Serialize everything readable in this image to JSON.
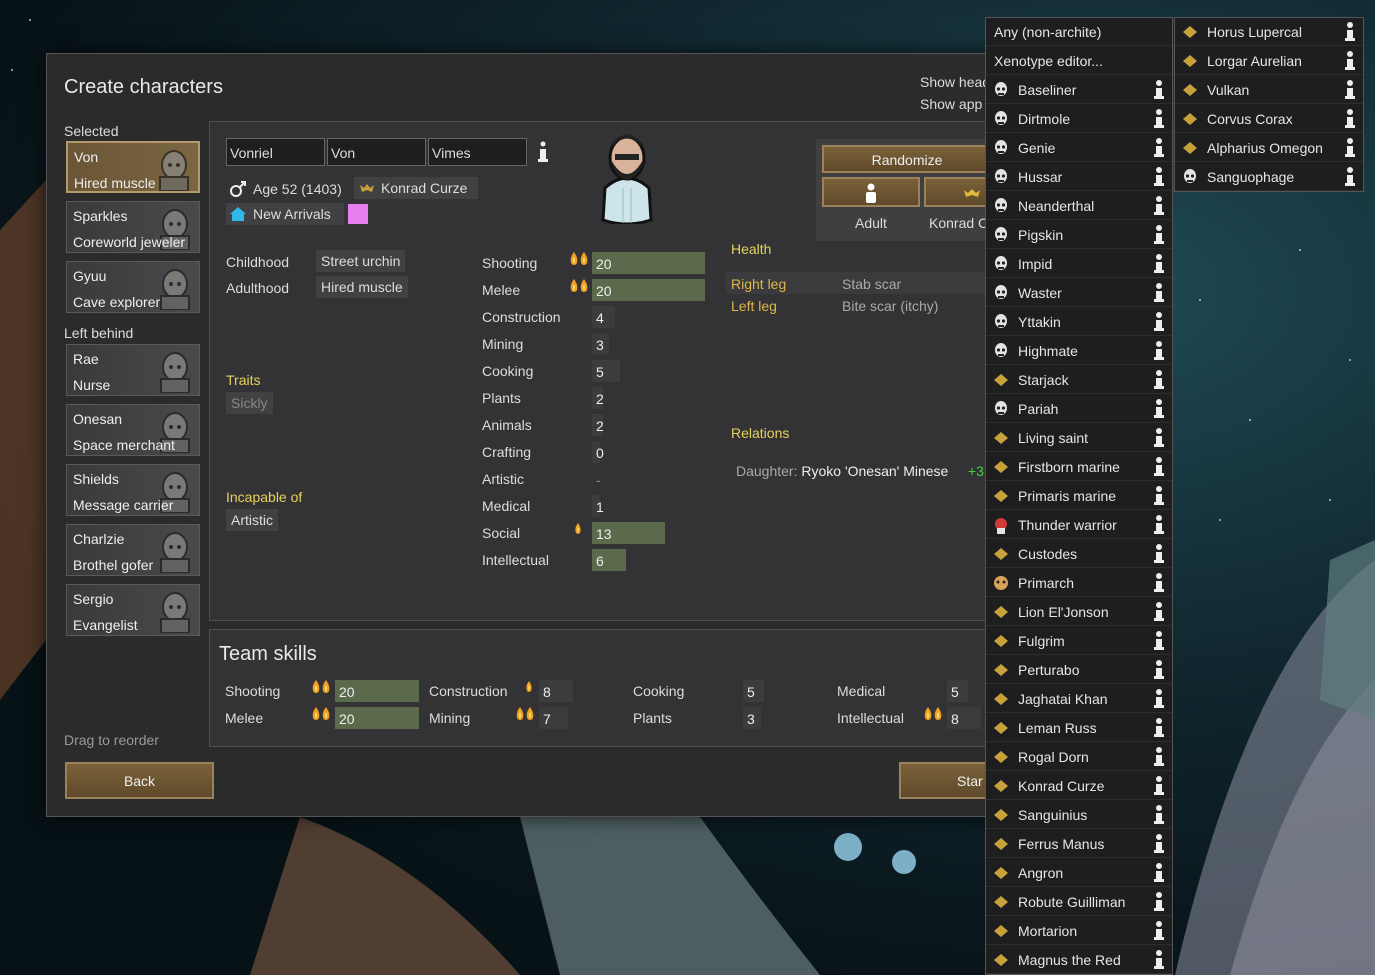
{
  "dialog": {
    "title": "Create characters",
    "selected_label": "Selected",
    "left_behind_label": "Left behind",
    "drag_hint": "Drag to reorder",
    "back_label": "Back",
    "start_label": "Star",
    "show_head_label": "Show head",
    "show_app_label": "Show app"
  },
  "selected_pawns": [
    {
      "name": "Von",
      "title": "Hired muscle"
    },
    {
      "name": "Sparkles",
      "title": "Coreworld jeweler"
    },
    {
      "name": "Gyuu",
      "title": "Cave explorer"
    }
  ],
  "left_behind_pawns": [
    {
      "name": "Rae",
      "title": "Nurse"
    },
    {
      "name": "Onesan",
      "title": "Space merchant"
    },
    {
      "name": "Shields",
      "title": "Message carrier"
    },
    {
      "name": "Charlzie",
      "title": "Brothel gofer"
    },
    {
      "name": "Sergio",
      "title": "Evangelist"
    }
  ],
  "pawn": {
    "first": "Vonriel",
    "nick": "Von",
    "last": "Vimes",
    "age": "Age 52 (1403)",
    "xenotype": "Konrad Curze",
    "faction": "New Arrivals",
    "favorite_color": "#e67ef0",
    "childhood_label": "Childhood",
    "childhood": "Street urchin",
    "adulthood_label": "Adulthood",
    "adulthood": "Hired muscle",
    "traits_label": "Traits",
    "traits": [
      "Sickly"
    ],
    "incapable_label": "Incapable of",
    "incapable": [
      "Artistic"
    ]
  },
  "skills": [
    {
      "name": "Shooting",
      "value": "20",
      "level": 20,
      "passion": 2
    },
    {
      "name": "Melee",
      "value": "20",
      "level": 20,
      "passion": 2
    },
    {
      "name": "Construction",
      "value": "4",
      "level": 4,
      "passion": 0
    },
    {
      "name": "Mining",
      "value": "3",
      "level": 3,
      "passion": 0
    },
    {
      "name": "Cooking",
      "value": "5",
      "level": 5,
      "passion": 0
    },
    {
      "name": "Plants",
      "value": "2",
      "level": 2,
      "passion": 0
    },
    {
      "name": "Animals",
      "value": "2",
      "level": 2,
      "passion": 0
    },
    {
      "name": "Crafting",
      "value": "0",
      "level": 0,
      "passion": 0
    },
    {
      "name": "Artistic",
      "value": "-",
      "level": 0,
      "passion": 0
    },
    {
      "name": "Medical",
      "value": "1",
      "level": 1,
      "passion": 0
    },
    {
      "name": "Social",
      "value": "13",
      "level": 13,
      "passion": 1
    },
    {
      "name": "Intellectual",
      "value": "6",
      "level": 6,
      "passion": 0
    }
  ],
  "randomize": {
    "label": "Randomize",
    "adult_label": "Adult",
    "xeno_label": "Konrad C"
  },
  "health": {
    "label": "Health",
    "rows": [
      {
        "part": "Right leg",
        "hediff": "Stab scar"
      },
      {
        "part": "Left leg",
        "hediff": "Bite scar (itchy)"
      }
    ]
  },
  "relations": {
    "label": "Relations",
    "rows": [
      {
        "kind": "Daughter:",
        "name": "Ryoko 'Onesan' Minese",
        "opinion": "+3"
      }
    ]
  },
  "team_skills": {
    "title": "Team skills",
    "items": [
      {
        "name": "Shooting",
        "value": "20",
        "level": 20,
        "passion": 2
      },
      {
        "name": "Melee",
        "value": "20",
        "level": 20,
        "passion": 2
      },
      {
        "name": "Construction",
        "value": "8",
        "level": 8,
        "passion": 1
      },
      {
        "name": "Mining",
        "value": "7",
        "level": 7,
        "passion": 2
      },
      {
        "name": "Cooking",
        "value": "5",
        "level": 5,
        "passion": 0
      },
      {
        "name": "Plants",
        "value": "3",
        "level": 3,
        "passion": 0
      },
      {
        "name": "Medical",
        "value": "5",
        "level": 5,
        "passion": 0
      },
      {
        "name": "Intellectual",
        "value": "8",
        "level": 8,
        "passion": 2
      }
    ]
  },
  "xenotype_menu": {
    "col1": [
      {
        "label": "Any (non-archite)",
        "icon": "none",
        "info": false
      },
      {
        "label": "Xenotype editor...",
        "icon": "none",
        "info": false
      },
      {
        "label": "Baseliner",
        "icon": "head-icon",
        "info": true
      },
      {
        "label": "Dirtmole",
        "icon": "goggles-head-icon",
        "info": true
      },
      {
        "label": "Genie",
        "icon": "head-icon",
        "info": true
      },
      {
        "label": "Hussar",
        "icon": "skull-head-icon",
        "info": true
      },
      {
        "label": "Neanderthal",
        "icon": "head-icon",
        "info": true
      },
      {
        "label": "Pigskin",
        "icon": "pig-head-icon",
        "info": true
      },
      {
        "label": "Impid",
        "icon": "horned-head-icon",
        "info": true
      },
      {
        "label": "Waster",
        "icon": "skull-head-icon",
        "info": true
      },
      {
        "label": "Yttakin",
        "icon": "furry-head-icon",
        "info": true
      },
      {
        "label": "Highmate",
        "icon": "head-icon",
        "info": true
      },
      {
        "label": "Starjack",
        "icon": "helmet-head-icon",
        "info": true
      },
      {
        "label": "Pariah",
        "icon": "head-icon",
        "info": true
      },
      {
        "label": "Living saint",
        "icon": "halo-icon",
        "info": true
      },
      {
        "label": "Firstborn marine",
        "icon": "marine-helmet-icon",
        "info": true
      },
      {
        "label": "Primaris marine",
        "icon": "marine-helmet-icon",
        "info": true
      },
      {
        "label": "Thunder warrior",
        "icon": "red-warrior-icon",
        "info": true
      },
      {
        "label": "Custodes",
        "icon": "custodes-helmet-icon",
        "info": true
      },
      {
        "label": "Primarch",
        "icon": "primarch-icon",
        "info": true
      },
      {
        "label": "Lion El'Jonson",
        "icon": "lion-sword-icon",
        "info": true
      },
      {
        "label": "Fulgrim",
        "icon": "feather-icon",
        "info": true
      },
      {
        "label": "Perturabo",
        "icon": "skull-gold-icon",
        "info": true
      },
      {
        "label": "Jaghatai Khan",
        "icon": "lightning-icon",
        "info": true
      },
      {
        "label": "Leman Russ",
        "icon": "wolf-icon",
        "info": true
      },
      {
        "label": "Rogal Dorn",
        "icon": "fist-icon",
        "info": true
      },
      {
        "label": "Konrad Curze",
        "icon": "bat-icon",
        "info": true
      },
      {
        "label": "Sanguinius",
        "icon": "wings-icon",
        "info": true
      },
      {
        "label": "Ferrus Manus",
        "icon": "hand-icon",
        "info": true
      },
      {
        "label": "Angron",
        "icon": "helm-icon",
        "info": true
      },
      {
        "label": "Robute Guilliman",
        "icon": "omega-icon",
        "info": true
      },
      {
        "label": "Mortarion",
        "icon": "fly-icon",
        "info": true
      },
      {
        "label": "Magnus the Red",
        "icon": "eye-icon",
        "info": true
      }
    ],
    "col2": [
      {
        "label": "Horus Lupercal",
        "icon": "eye-wing-icon",
        "info": true
      },
      {
        "label": "Lorgar Aurelian",
        "icon": "book-icon",
        "info": true
      },
      {
        "label": "Vulkan",
        "icon": "salamander-icon",
        "info": true
      },
      {
        "label": "Corvus Corax",
        "icon": "raven-icon",
        "info": true
      },
      {
        "label": "Alpharius Omegon",
        "icon": "hydra-icon",
        "info": true
      },
      {
        "label": "Sanguophage",
        "icon": "head-icon",
        "info": true
      }
    ]
  }
}
